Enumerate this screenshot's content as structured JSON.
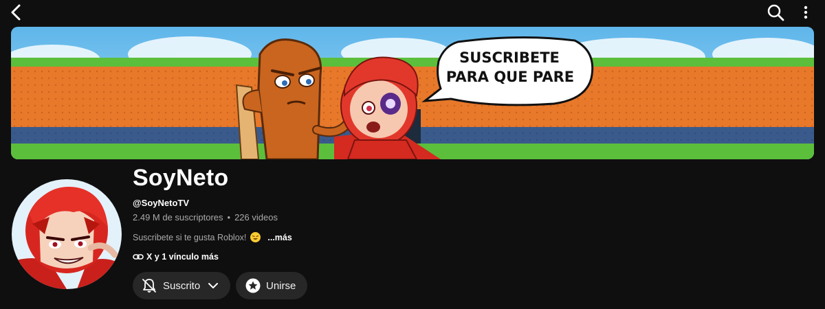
{
  "banner": {
    "speech_line1": "SUSCRIBETE",
    "speech_line2": "PARA QUE PARE"
  },
  "channel": {
    "name": "SoyNeto",
    "handle": "@SoyNetoTV",
    "subscribers": "2.49 M de suscriptores",
    "separator": "•",
    "videos": "226 videos",
    "description": "Suscribete si te gusta Roblox!",
    "more": "...más",
    "links": "X y 1 vínculo más"
  },
  "actions": {
    "subscribed_label": "Suscrito",
    "join_label": "Unirse"
  },
  "colors": {
    "background": "#0f0f0f",
    "button_bg": "#272727",
    "secondary_text": "#aaaaaa"
  },
  "icons": {
    "back": "chevron-left-icon",
    "search": "search-icon",
    "more": "more-vert-icon",
    "bell": "bell-off-icon",
    "dropdown": "chevron-down-icon",
    "join": "star-badge-icon",
    "link": "link-icon",
    "emoji": "laughing-emoji-icon"
  }
}
